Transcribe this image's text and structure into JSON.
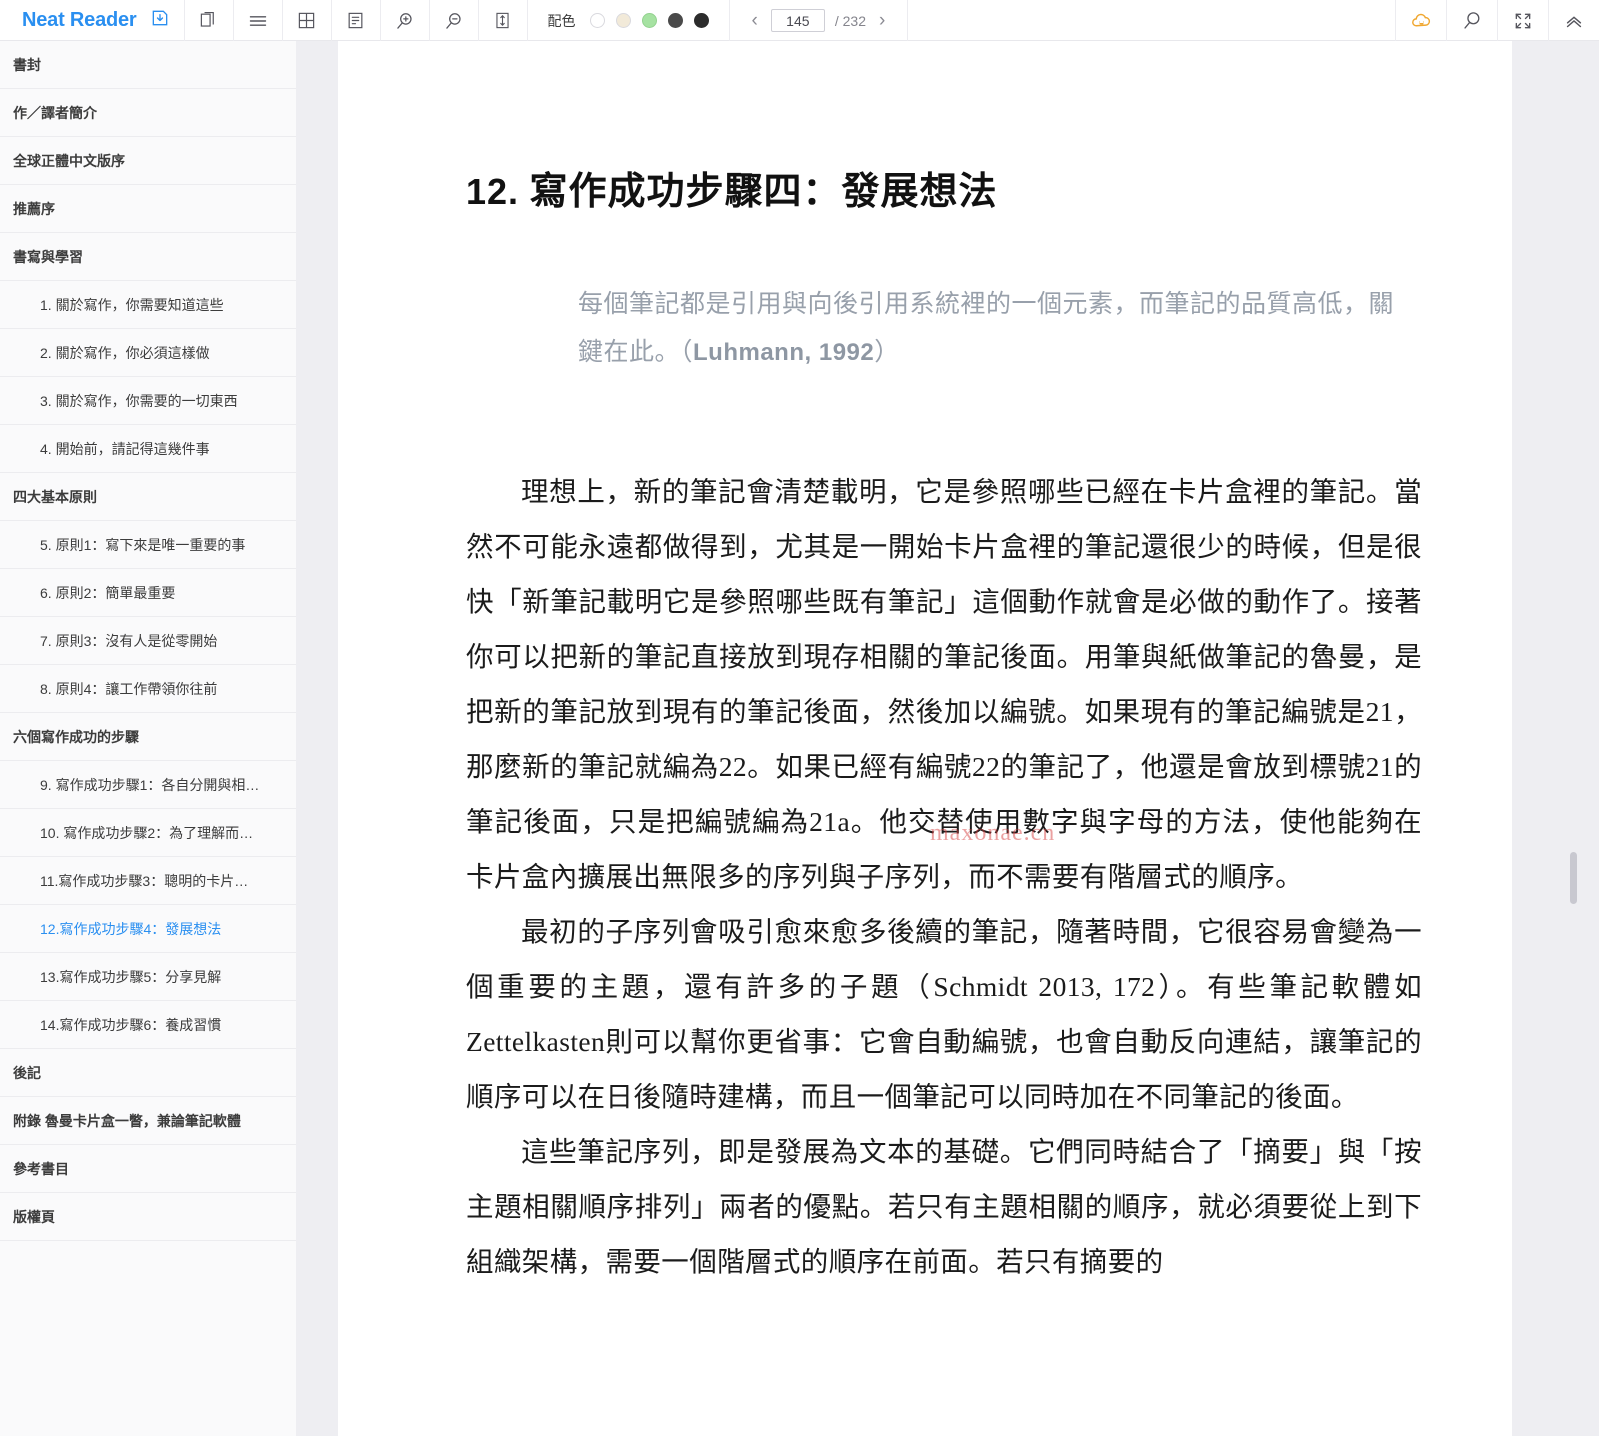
{
  "app": {
    "brand": "Neat Reader"
  },
  "toolbar": {
    "save_icon": "save-book-icon",
    "left_tools": [
      {
        "name": "two-page-view-icon",
        "label": "two-page-view"
      },
      {
        "name": "toc-list-icon",
        "label": "contents-list"
      },
      {
        "name": "grid-view-icon",
        "label": "grid-view"
      },
      {
        "name": "note-panel-icon",
        "label": "notes-panel"
      },
      {
        "name": "zoom-in-icon",
        "label": "zoom-in"
      },
      {
        "name": "zoom-out-icon",
        "label": "zoom-out"
      },
      {
        "name": "line-height-icon",
        "label": "line-spacing"
      }
    ],
    "scheme": {
      "label": "配色",
      "swatches": [
        {
          "name": "swatch-white",
          "color": "#ffffff"
        },
        {
          "name": "swatch-sepia",
          "color": "#f2ead9"
        },
        {
          "name": "swatch-green",
          "color": "#a6e2a2"
        },
        {
          "name": "swatch-gray",
          "color": "#4a4a4a"
        },
        {
          "name": "swatch-black",
          "color": "#2c2c2c"
        }
      ]
    },
    "pager": {
      "prev": "‹",
      "next": "›",
      "current_page": "145",
      "total_label": "/ 232",
      "placeholder": "145"
    },
    "right_tools": [
      {
        "name": "cloud-sync-icon",
        "label": "cloud-sync",
        "color": "#f0a730"
      },
      {
        "name": "search-icon",
        "label": "search"
      },
      {
        "name": "fullscreen-icon",
        "label": "fullscreen"
      },
      {
        "name": "collapse-toolbar-icon",
        "label": "collapse"
      }
    ]
  },
  "sidebar": {
    "items": [
      {
        "label": "書封",
        "level": 1,
        "active": false
      },
      {
        "label": "作／譯者簡介",
        "level": 1,
        "active": false
      },
      {
        "label": "全球正體中文版序",
        "level": 1,
        "active": false
      },
      {
        "label": "推薦序",
        "level": 1,
        "active": false
      },
      {
        "label": "書寫與學習",
        "level": 1,
        "active": false
      },
      {
        "label": "1. 關於寫作，你需要知道這些",
        "level": 2,
        "active": false
      },
      {
        "label": "2. 關於寫作，你必須這樣做",
        "level": 2,
        "active": false
      },
      {
        "label": "3. 關於寫作，你需要的一切東西",
        "level": 2,
        "active": false
      },
      {
        "label": "4. 開始前，請記得這幾件事",
        "level": 2,
        "active": false
      },
      {
        "label": "四大基本原則",
        "level": 1,
        "active": false
      },
      {
        "label": "5. 原則1：寫下來是唯一重要的事",
        "level": 2,
        "active": false
      },
      {
        "label": "6. 原則2：簡單最重要",
        "level": 2,
        "active": false
      },
      {
        "label": "7. 原則3：沒有人是從零開始",
        "level": 2,
        "active": false
      },
      {
        "label": "8. 原則4：讓工作帶領你往前",
        "level": 2,
        "active": false
      },
      {
        "label": "六個寫作成功的步驟",
        "level": 1,
        "active": false
      },
      {
        "label": "9. 寫作成功步驟1：各自分開與相…",
        "level": 2,
        "active": false
      },
      {
        "label": "10. 寫作成功步驟2：為了理解而…",
        "level": 2,
        "active": false
      },
      {
        "label": "11.寫作成功步驟3：聰明的卡片…",
        "level": 2,
        "active": false
      },
      {
        "label": "12.寫作成功步驟4：發展想法",
        "level": 2,
        "active": true
      },
      {
        "label": "13.寫作成功步驟5：分享見解",
        "level": 2,
        "active": false
      },
      {
        "label": "14.寫作成功步驟6：養成習慣",
        "level": 2,
        "active": false
      },
      {
        "label": "後記",
        "level": 1,
        "active": false
      },
      {
        "label": "附錄 魯曼卡片盒一瞥，兼論筆記軟體",
        "level": 1,
        "active": false
      },
      {
        "label": "參考書目",
        "level": 1,
        "active": false
      },
      {
        "label": "版權頁",
        "level": 1,
        "active": false
      }
    ]
  },
  "content": {
    "chapter_number": "12.",
    "chapter_title": "寫作成功步驟四：發展想法",
    "epigraph_text": "每個筆記都是引用與向後引用系統裡的一個元素，而筆記的品質高低，關鍵在此。（",
    "epigraph_citation": "Luhmann, 1992",
    "epigraph_tail": "）",
    "paragraphs": [
      "理想上，新的筆記會清楚載明，它是參照哪些已經在卡片盒裡的筆記。當然不可能永遠都做得到，尤其是一開始卡片盒裡的筆記還很少的時候，但是很快「新筆記載明它是參照哪些既有筆記」這個動作就會是必做的動作了。接著你可以把新的筆記直接放到現存相關的筆記後面。用筆與紙做筆記的魯曼，是把新的筆記放到現有的筆記後面，然後加以編號。如果現有的筆記編號是21，那麼新的筆記就編為22。如果已經有編號22的筆記了，他還是會放到標號21的筆記後面，只是把編號編為21a。他交替使用數字與字母的方法，使他能夠在卡片盒內擴展出無限多的序列與子序列，而不需要有階層式的順序。",
      "最初的子序列會吸引愈來愈多後續的筆記，隨著時間，它很容易會變為一個重要的主題，還有許多的子題（Schmidt 2013, 172）。有些筆記軟體如Zettelkasten則可以幫你更省事：它會自動編號，也會自動反向連結，讓筆記的順序可以在日後隨時建構，而且一個筆記可以同時加在不同筆記的後面。",
      "這些筆記序列，即是發展為文本的基礎。它們同時結合了「摘要」與「按主題相關順序排列」兩者的優點。若只有主題相關的順序，就必須要從上到下組織架構，需要一個階層式的順序在前面。若只有摘要的"
    ],
    "watermark": "maxonae.cn"
  },
  "colors": {
    "brand": "#2a8ff0",
    "active": "#2a8ff0",
    "sidebar_bg": "#fafafb",
    "gutter_bg": "#eeeef2",
    "page_bg": "#ffffff",
    "cloud_icon": "#f0a730"
  }
}
